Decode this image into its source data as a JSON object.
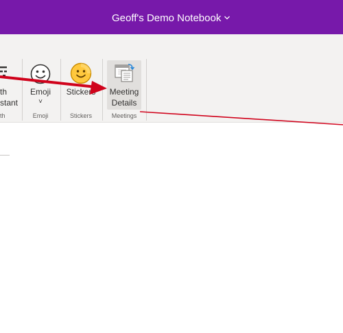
{
  "titlebar": {
    "notebook_name": "Geoff's Demo Notebook",
    "chevron_icon": "chevron-down-icon",
    "background": "#7719aa"
  },
  "ribbon": {
    "partial_button": {
      "label_line1": "th",
      "label_line2": "stant"
    },
    "partial_group_label": "th",
    "emoji": {
      "icon": "smiley-outline-icon",
      "label": "Emoji",
      "chevron": "˅",
      "group_label": "Emoji"
    },
    "stickers": {
      "icon": "smiley-sticker-icon",
      "label": "Stickers",
      "group_label": "Stickers"
    },
    "meetings": {
      "icon": "calendar-meeting-icon",
      "label_line1": "Meeting",
      "label_line2": "Details",
      "group_label": "Meetings"
    }
  },
  "annotations": {
    "arrow_color": "#d0021b"
  }
}
